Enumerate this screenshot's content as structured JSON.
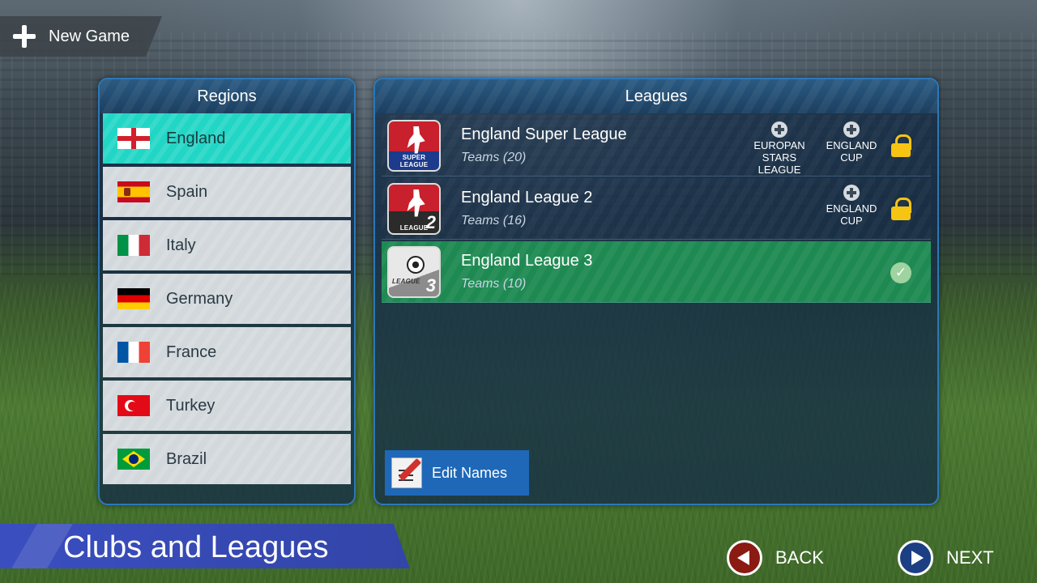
{
  "header": {
    "new_game_label": "New Game"
  },
  "regions": {
    "title": "Regions",
    "items": [
      {
        "label": "England",
        "selected": true
      },
      {
        "label": "Spain"
      },
      {
        "label": "Italy"
      },
      {
        "label": "Germany"
      },
      {
        "label": "France"
      },
      {
        "label": "Turkey"
      },
      {
        "label": "Brazil"
      }
    ]
  },
  "leagues": {
    "title": "Leagues",
    "items": [
      {
        "name": "England Super League",
        "teams": "Teams (20)",
        "logo_text": "SUPER LEAGUE",
        "cup_1": "EUROPAN STARS LEAGUE",
        "cup_2": "ENGLAND CUP",
        "status": "locked"
      },
      {
        "name": "England League 2",
        "teams": "Teams (16)",
        "logo_text": "LEAGUE",
        "logo_num": "2",
        "cup_2": "ENGLAND CUP",
        "status": "locked"
      },
      {
        "name": "England League 3",
        "teams": "Teams (10)",
        "logo_text": "LEAGUE",
        "logo_num": "3",
        "status": "selected"
      }
    ],
    "edit_names_label": "Edit Names"
  },
  "footer": {
    "title": "Clubs and Leagues",
    "back_label": "BACK",
    "next_label": "NEXT"
  },
  "colors": {
    "selected_region": "#22d6c6",
    "selected_league": "#1e8a52",
    "panel_border": "#2c78b8",
    "lock": "#f6c412"
  }
}
